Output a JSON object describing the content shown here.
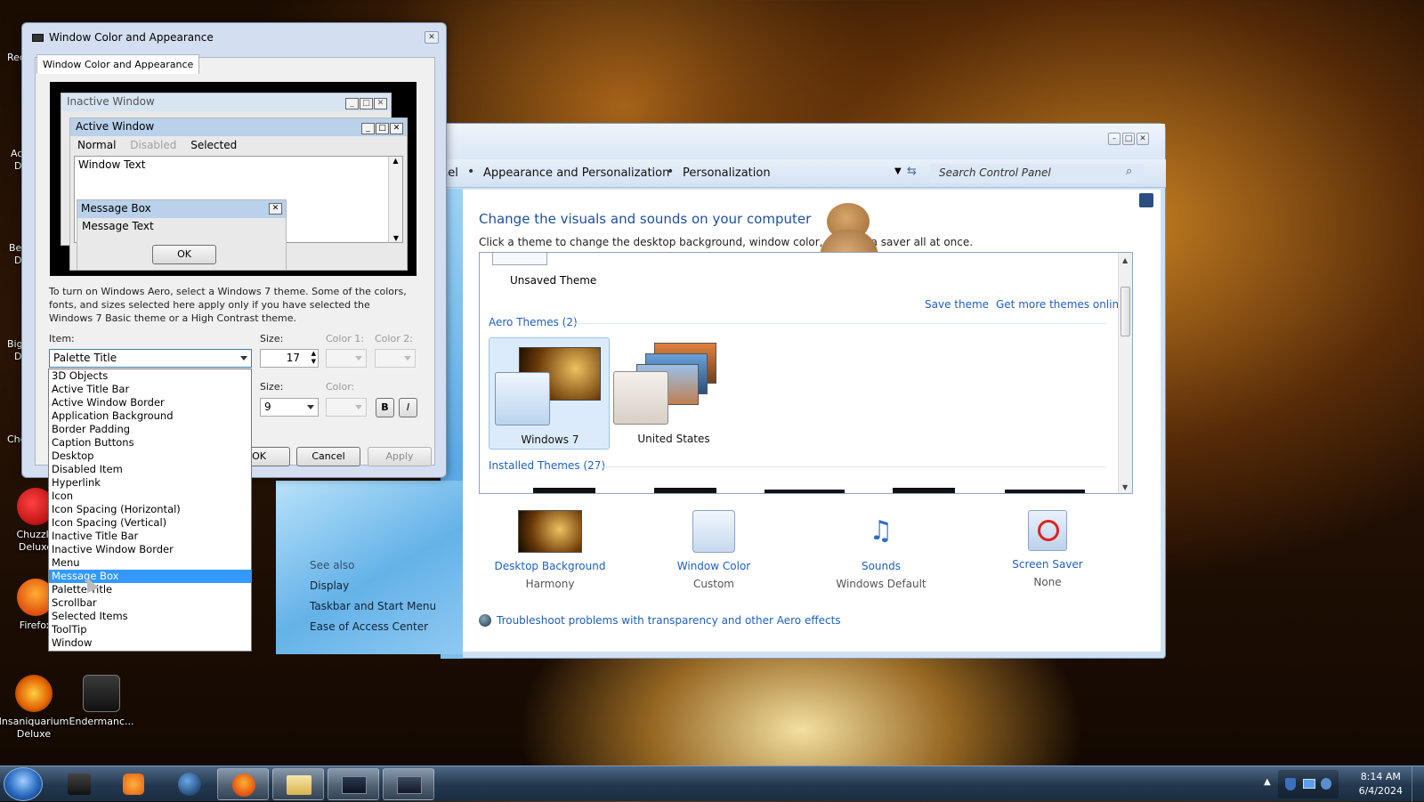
{
  "desktop": {
    "edge_labels": [
      "Rec",
      "Ac",
      "D",
      "Be",
      "D",
      "Big",
      "D",
      "Che"
    ],
    "icons": [
      {
        "label": "Chuzzle Deluxe",
        "icon": "chuzzle-icon"
      },
      {
        "label": "Firefox",
        "icon": "firefox-icon"
      },
      {
        "label": "Insaniquarium Deluxe",
        "icon": "insaniquarium-icon"
      },
      {
        "label": "Endermanc...",
        "icon": "endermanch-icon"
      }
    ]
  },
  "control_panel": {
    "breadcrumbs": [
      "nel",
      "Appearance and Personalization",
      "Personalization"
    ],
    "search_placeholder": "Search Control Panel",
    "heading": "Change the visuals and sounds on your computer",
    "subheading": "Click a theme to change the desktop background, window color, sounds, a      saver all at once.",
    "my_themes": {
      "unsaved_label": "Unsaved Theme"
    },
    "save_theme": "Save theme",
    "get_more": "Get more themes online",
    "aero_section": "Aero Themes (2)",
    "aero_themes": [
      "Windows 7",
      "United States"
    ],
    "installed_section": "Installed Themes (27)",
    "bottom": [
      {
        "label": "Desktop Background",
        "sub": "Harmony"
      },
      {
        "label": "Window Color",
        "sub": "Custom"
      },
      {
        "label": "Sounds",
        "sub": "Windows Default"
      },
      {
        "label": "Screen Saver",
        "sub": "None"
      }
    ],
    "troubleshoot": "Troubleshoot problems with transparency and other Aero effects",
    "see_also": {
      "heading": "See also",
      "links": [
        "Display",
        "Taskbar and Start Menu",
        "Ease of Access Center"
      ]
    }
  },
  "dialog": {
    "title": "Window Color and Appearance",
    "tab": "Window Color and Appearance",
    "preview": {
      "inactive_title": "Inactive Window",
      "active_title": "Active Window",
      "menu": [
        "Normal",
        "Disabled",
        "Selected"
      ],
      "window_text": "Window Text",
      "msgbox_title": "Message Box",
      "msgbox_text": "Message Text",
      "ok": "OK"
    },
    "info": "To turn on Windows Aero, select a Windows 7 theme.  Some of the colors, fonts, and sizes selected here apply only if you have selected the Windows 7 Basic theme or a High Contrast theme.",
    "item_label": "Item:",
    "item_value": "Palette Title",
    "size_label": "Size:",
    "size_value": "17",
    "color1_label": "Color 1:",
    "color2_label": "Color 2:",
    "font_size_label": "Size:",
    "font_size_value": "9",
    "font_color_label": "Color:",
    "bold": "B",
    "italic": "I",
    "buttons": {
      "ok": "OK",
      "cancel": "Cancel",
      "apply": "Apply"
    },
    "item_options": [
      "3D Objects",
      "Active Title Bar",
      "Active Window Border",
      "Application Background",
      "Border Padding",
      "Caption Buttons",
      "Desktop",
      "Disabled Item",
      "Hyperlink",
      "Icon",
      "Icon Spacing (Horizontal)",
      "Icon Spacing (Vertical)",
      "Inactive Title Bar",
      "Inactive Window Border",
      "Menu",
      "Message Box",
      "Palette Title",
      "Scrollbar",
      "Selected Items",
      "ToolTip",
      "Window"
    ],
    "highlighted_option": "Message Box"
  },
  "taskbar": {
    "time": "8:14 AM",
    "date": "6/4/2024"
  },
  "colors": {
    "accent": "#1e5fbd",
    "selection": "#3399ff",
    "active_title": "#b9d1ea",
    "inactive_title": "#d7e4f2"
  }
}
